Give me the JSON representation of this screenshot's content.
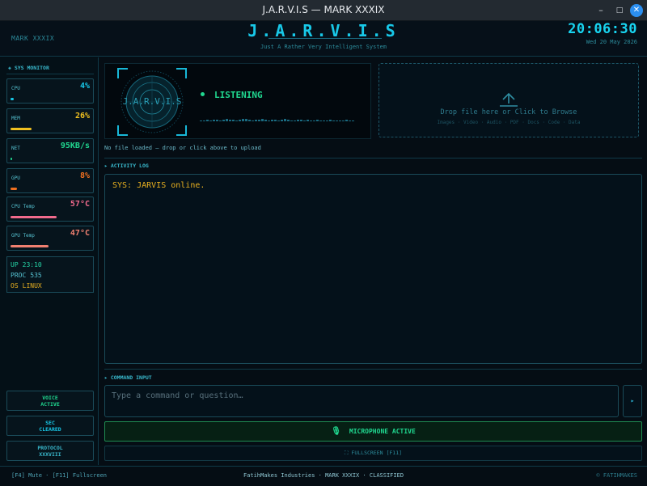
{
  "window": {
    "title": "J.A.R.V.I.S — MARK XXXIX",
    "minimize_glyph": "–",
    "maximize_glyph": "□",
    "close_glyph": "✕"
  },
  "header": {
    "left_label": "MARK XXXIX",
    "title": "J.A.R.V.I.S",
    "subtitle": "Just A Rather Very Intelligent System",
    "time": "20:06:30",
    "date": "Wed 20 May 2026"
  },
  "sidebar": {
    "heading": "◈ SYS MONITOR",
    "metrics": [
      {
        "label": "CPU",
        "value": "4%",
        "fill": 0.04,
        "color": "#18c8e8"
      },
      {
        "label": "MEM",
        "value": "26%",
        "fill": 0.26,
        "color": "#f0c020"
      },
      {
        "label": "NET",
        "value": "95KB/s",
        "fill": 0.02,
        "color": "#20d890"
      },
      {
        "label": "GPU",
        "value": "8%",
        "fill": 0.08,
        "color": "#f07020"
      },
      {
        "label": "CPU Temp",
        "value": "57°C",
        "fill": 0.57,
        "color": "#f06a8c"
      },
      {
        "label": "GPU Temp",
        "value": "47°C",
        "fill": 0.47,
        "color": "#f08070"
      }
    ],
    "info": {
      "uptime_label": "UP",
      "uptime": "23:10",
      "proc_label": "PROC",
      "proc": "535",
      "os_label": "OS",
      "os": "LINUX"
    },
    "buttons": [
      {
        "line1": "VOICE",
        "line2": "ACTIVE",
        "color": "#20d890"
      },
      {
        "line1": "SEC",
        "line2": "CLEARED",
        "color": "#18c8e8"
      },
      {
        "line1": "PROTOCOL",
        "line2": "XXXVIII",
        "color": "#39b8cc"
      }
    ]
  },
  "main": {
    "reactor_label": "J.A.R.V.I.S",
    "status": "LISTENING",
    "upload": {
      "main_text": "Drop file here  or  Click to Browse",
      "types": "Images · Video · Audio · PDF · Docs · Code · Data"
    },
    "file_hint": "No file loaded — drop or click above to upload",
    "activity_heading": "▸ ACTIVITY LOG",
    "log": [
      "SYS: JARVIS online."
    ],
    "command_heading": "▸ COMMAND INPUT",
    "command_placeholder": "Type a command or question…",
    "send_glyph": "▸",
    "mic_glyph": "🎙",
    "mic_label": "MICROPHONE ACTIVE",
    "fullscreen_label": "⛶  FULLSCREEN  [F11]"
  },
  "footer": {
    "left": "[F4] Mute  ·  [F11] Fullscreen",
    "center": "FatihMakes Industries  ·  MARK XXXIX  ·  CLASSIFIED",
    "right": "© FATIHMAKES"
  },
  "colors": {
    "accent": "#18c8e8",
    "active_green": "#20d890",
    "log_text": "#e8b020"
  }
}
